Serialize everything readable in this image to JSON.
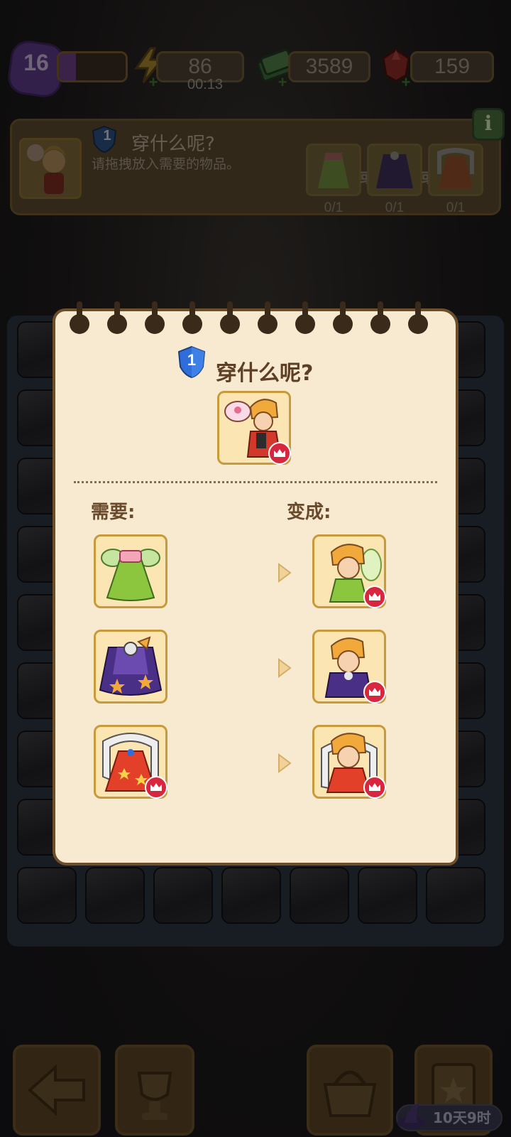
{
  "status": {
    "level": "16",
    "xp_fraction": 0.25,
    "energy": "86",
    "energy_timer": "00:13",
    "cash": "3589",
    "gems": "159"
  },
  "order": {
    "badge": "1",
    "title": "穿什么呢?",
    "subtitle": "请拖拽放入需要的物品。",
    "separator": "或",
    "slots": [
      {
        "icon": "green-fairy-dress-icon",
        "count": "0/1"
      },
      {
        "icon": "purple-wizard-robe-icon",
        "count": "0/1"
      },
      {
        "icon": "red-royal-gown-icon",
        "count": "0/1"
      }
    ]
  },
  "modal": {
    "badge": "1",
    "title": "穿什么呢?",
    "need_label": "需要:",
    "become_label": "变成:",
    "rows": [
      {
        "need_icon": "green-fairy-dress-icon",
        "need_premium": false,
        "result_icon": "fairy-character-icon"
      },
      {
        "need_icon": "purple-wizard-robe-icon",
        "need_premium": false,
        "result_icon": "wizard-character-icon"
      },
      {
        "need_icon": "red-royal-gown-icon",
        "need_premium": true,
        "result_icon": "royal-character-icon"
      }
    ]
  },
  "bottom": {
    "event_timer": "10天9时"
  },
  "colors": {
    "paper": "#f8ead0",
    "tile_bg": "#fbe5b2",
    "tile_border": "#c79a3b",
    "crown_badge": "#d9263f",
    "shield_blue": "#2f6ed8"
  }
}
